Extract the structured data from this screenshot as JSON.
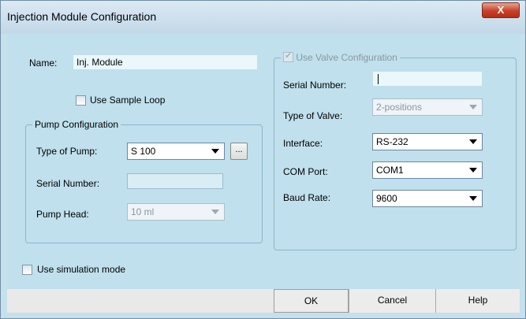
{
  "window": {
    "title": "Injection Module Configuration",
    "close_label": "X"
  },
  "module": {
    "name_label": "Name:",
    "name_value": "Inj. Module",
    "use_sample_loop_label": "Use Sample Loop"
  },
  "pump": {
    "group_title": "Pump Configuration",
    "type_label": "Type of Pump:",
    "type_value": "S 100",
    "browse_label": "...",
    "serial_label": "Serial Number:",
    "serial_value": "",
    "head_label": "Pump Head:",
    "head_value": "10 ml"
  },
  "valve": {
    "group_title": "Use Valve Configuration",
    "serial_label": "Serial Number:",
    "serial_value": "",
    "type_label": "Type of Valve:",
    "type_value": "2-positions",
    "interface_label": "Interface:",
    "interface_value": "RS-232",
    "com_label": "COM Port:",
    "com_value": "COM1",
    "baud_label": "Baud Rate:",
    "baud_value": "9600"
  },
  "simulation": {
    "label": "Use simulation mode"
  },
  "buttons": {
    "ok": "OK",
    "cancel": "Cancel",
    "help": "Help"
  },
  "colors": {
    "accent": "#c6412a",
    "client_bg": "#bfe0ec"
  }
}
